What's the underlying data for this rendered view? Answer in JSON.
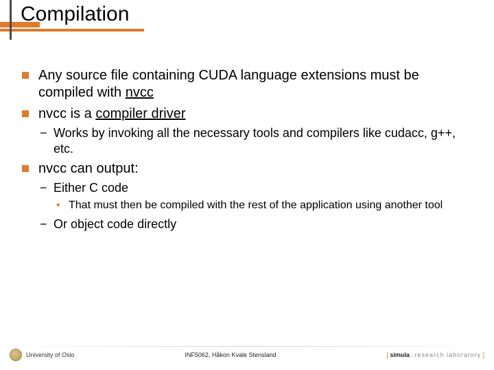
{
  "title": "Compilation",
  "bullets": {
    "b1": "Any source file containing CUDA language extensions must be compiled with ",
    "b1_u": "nvcc",
    "b2_pre": "nvcc is a ",
    "b2_u": "compiler driver",
    "b2_sub1": "Works by invoking all the necessary tools and compilers like cudacc, g++, etc.",
    "b3": "nvcc can output:",
    "b3_sub1": "Either C code",
    "b3_sub1_sub1": "That must then be compiled with the rest of the application using another tool",
    "b3_sub2": "Or object code directly"
  },
  "footer": {
    "left": "University of Oslo",
    "center": "INF5062, Håkon Kvale Stensland",
    "right_bracket_open": "[ ",
    "right_simula": "simula",
    "right_dot": " . ",
    "right_lab": "research laboratory",
    "right_bracket_close": " ]"
  }
}
